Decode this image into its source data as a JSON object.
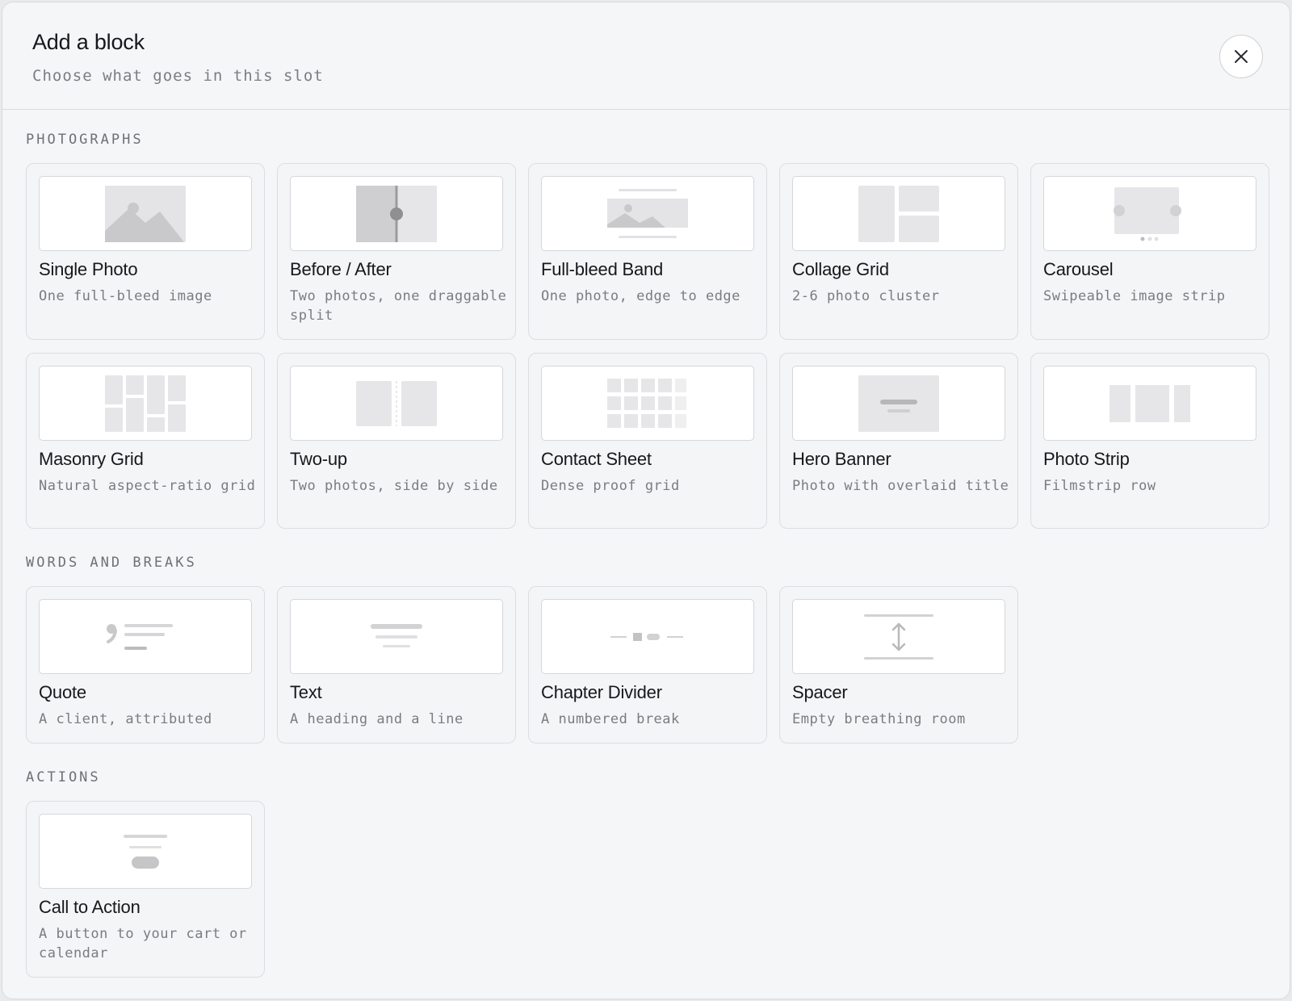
{
  "header": {
    "title": "Add a block",
    "subtitle": "Choose what goes in this slot",
    "close_icon": "close-icon"
  },
  "sections": [
    {
      "label": "PHOTOGRAPHS",
      "items": [
        {
          "id": "single-photo",
          "title": "Single Photo",
          "description": "One full-bleed image",
          "icon": "single-photo-icon"
        },
        {
          "id": "before-after",
          "title": "Before / After",
          "description": "Two photos, one draggable split",
          "icon": "before-after-icon"
        },
        {
          "id": "full-bleed-band",
          "title": "Full-bleed Band",
          "description": "One photo, edge to edge",
          "icon": "full-bleed-band-icon"
        },
        {
          "id": "collage-grid",
          "title": "Collage Grid",
          "description": "2-6 photo cluster",
          "icon": "collage-grid-icon"
        },
        {
          "id": "carousel",
          "title": "Carousel",
          "description": "Swipeable image strip",
          "icon": "carousel-icon"
        },
        {
          "id": "masonry-grid",
          "title": "Masonry Grid",
          "description": "Natural aspect-ratio grid",
          "icon": "masonry-grid-icon"
        },
        {
          "id": "two-up",
          "title": "Two-up",
          "description": "Two photos, side by side",
          "icon": "two-up-icon"
        },
        {
          "id": "contact-sheet",
          "title": "Contact Sheet",
          "description": "Dense proof grid",
          "icon": "contact-sheet-icon"
        },
        {
          "id": "hero-banner",
          "title": "Hero Banner",
          "description": "Photo with overlaid title",
          "icon": "hero-banner-icon"
        },
        {
          "id": "photo-strip",
          "title": "Photo Strip",
          "description": "Filmstrip row",
          "icon": "photo-strip-icon"
        }
      ]
    },
    {
      "label": "WORDS AND BREAKS",
      "items": [
        {
          "id": "quote",
          "title": "Quote",
          "description": "A client, attributed",
          "icon": "quote-icon"
        },
        {
          "id": "text",
          "title": "Text",
          "description": "A heading and a line",
          "icon": "text-icon"
        },
        {
          "id": "chapter-divider",
          "title": "Chapter Divider",
          "description": "A numbered break",
          "icon": "chapter-divider-icon"
        },
        {
          "id": "spacer",
          "title": "Spacer",
          "description": "Empty breathing room",
          "icon": "spacer-icon"
        }
      ]
    },
    {
      "label": "ACTIONS",
      "items": [
        {
          "id": "call-to-action",
          "title": "Call to Action",
          "description": "A button to your cart or calendar",
          "icon": "call-to-action-icon"
        }
      ]
    }
  ]
}
